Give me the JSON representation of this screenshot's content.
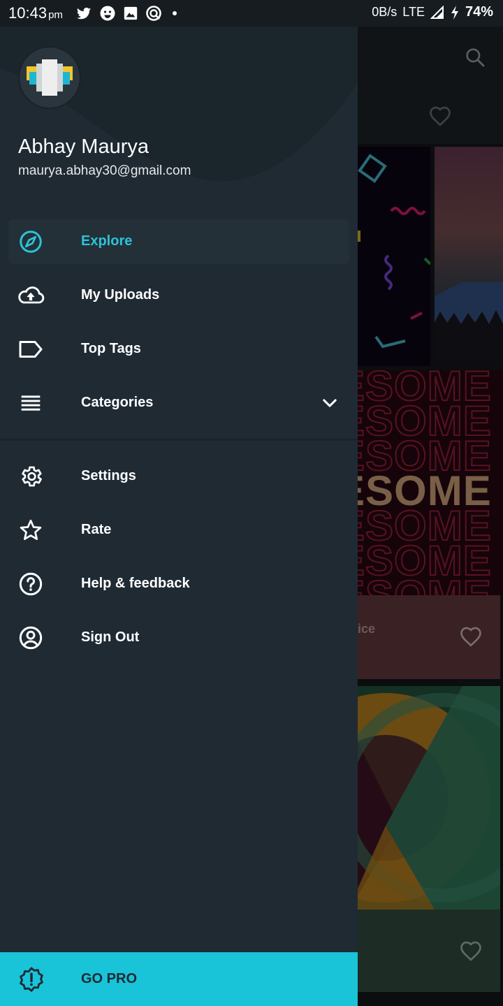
{
  "status_bar": {
    "time": "10:43",
    "ampm": "pm",
    "net_speed": "0B/s",
    "network": "LTE",
    "battery": "74%"
  },
  "drawer": {
    "user_name": "Abhay Maurya",
    "user_email": "maurya.abhay30@gmail.com",
    "menu": {
      "explore": "Explore",
      "uploads": "My Uploads",
      "top_tags": "Top Tags",
      "categories": "Categories",
      "settings": "Settings",
      "rate": "Rate",
      "help": "Help & feedback",
      "sign_out": "Sign Out"
    },
    "go_pro": "GO PRO"
  },
  "background": {
    "card_word": "ESOME",
    "card_caption": "ice"
  },
  "colors": {
    "accent": "#2cc3d8",
    "drawer_bg": "#1f2a33",
    "go_pro_bg": "#19c3d8"
  }
}
